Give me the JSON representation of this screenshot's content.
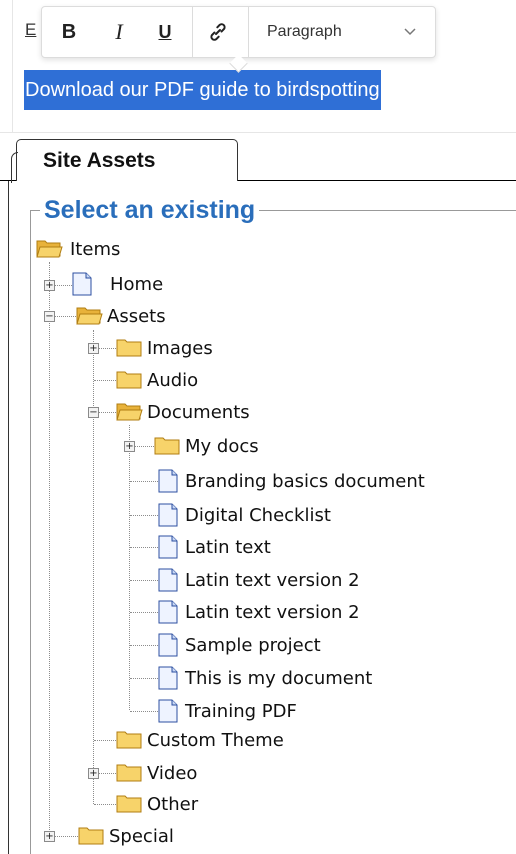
{
  "editor": {
    "hidden_letter": "E",
    "selected_text": "Download our PDF guide to birdspotting"
  },
  "toolbar": {
    "bold_label": "B",
    "italic_label": "I",
    "underline_label": "U",
    "link_icon": "link-icon",
    "format_select_value": "Paragraph",
    "chevron": "chevron-down-icon"
  },
  "tab": {
    "label": "Site Assets"
  },
  "fieldset": {
    "legend": "Select an existing"
  },
  "tree": {
    "root": "Items",
    "home": "Home",
    "assets": "Assets",
    "images": "Images",
    "audio": "Audio",
    "documents": "Documents",
    "my_docs": "My docs",
    "docs": [
      "Branding basics document",
      "Digital Checklist",
      "Latin text",
      "Latin text version 2",
      "Latin text version 2",
      "Sample project",
      "This is my document",
      "Training PDF"
    ],
    "custom_theme": "Custom Theme",
    "video": "Video",
    "other": "Other",
    "special": "Special"
  },
  "colors": {
    "selection": "#2f6fd6",
    "legend": "#2a6ebb",
    "folder": "#f3c54a"
  }
}
